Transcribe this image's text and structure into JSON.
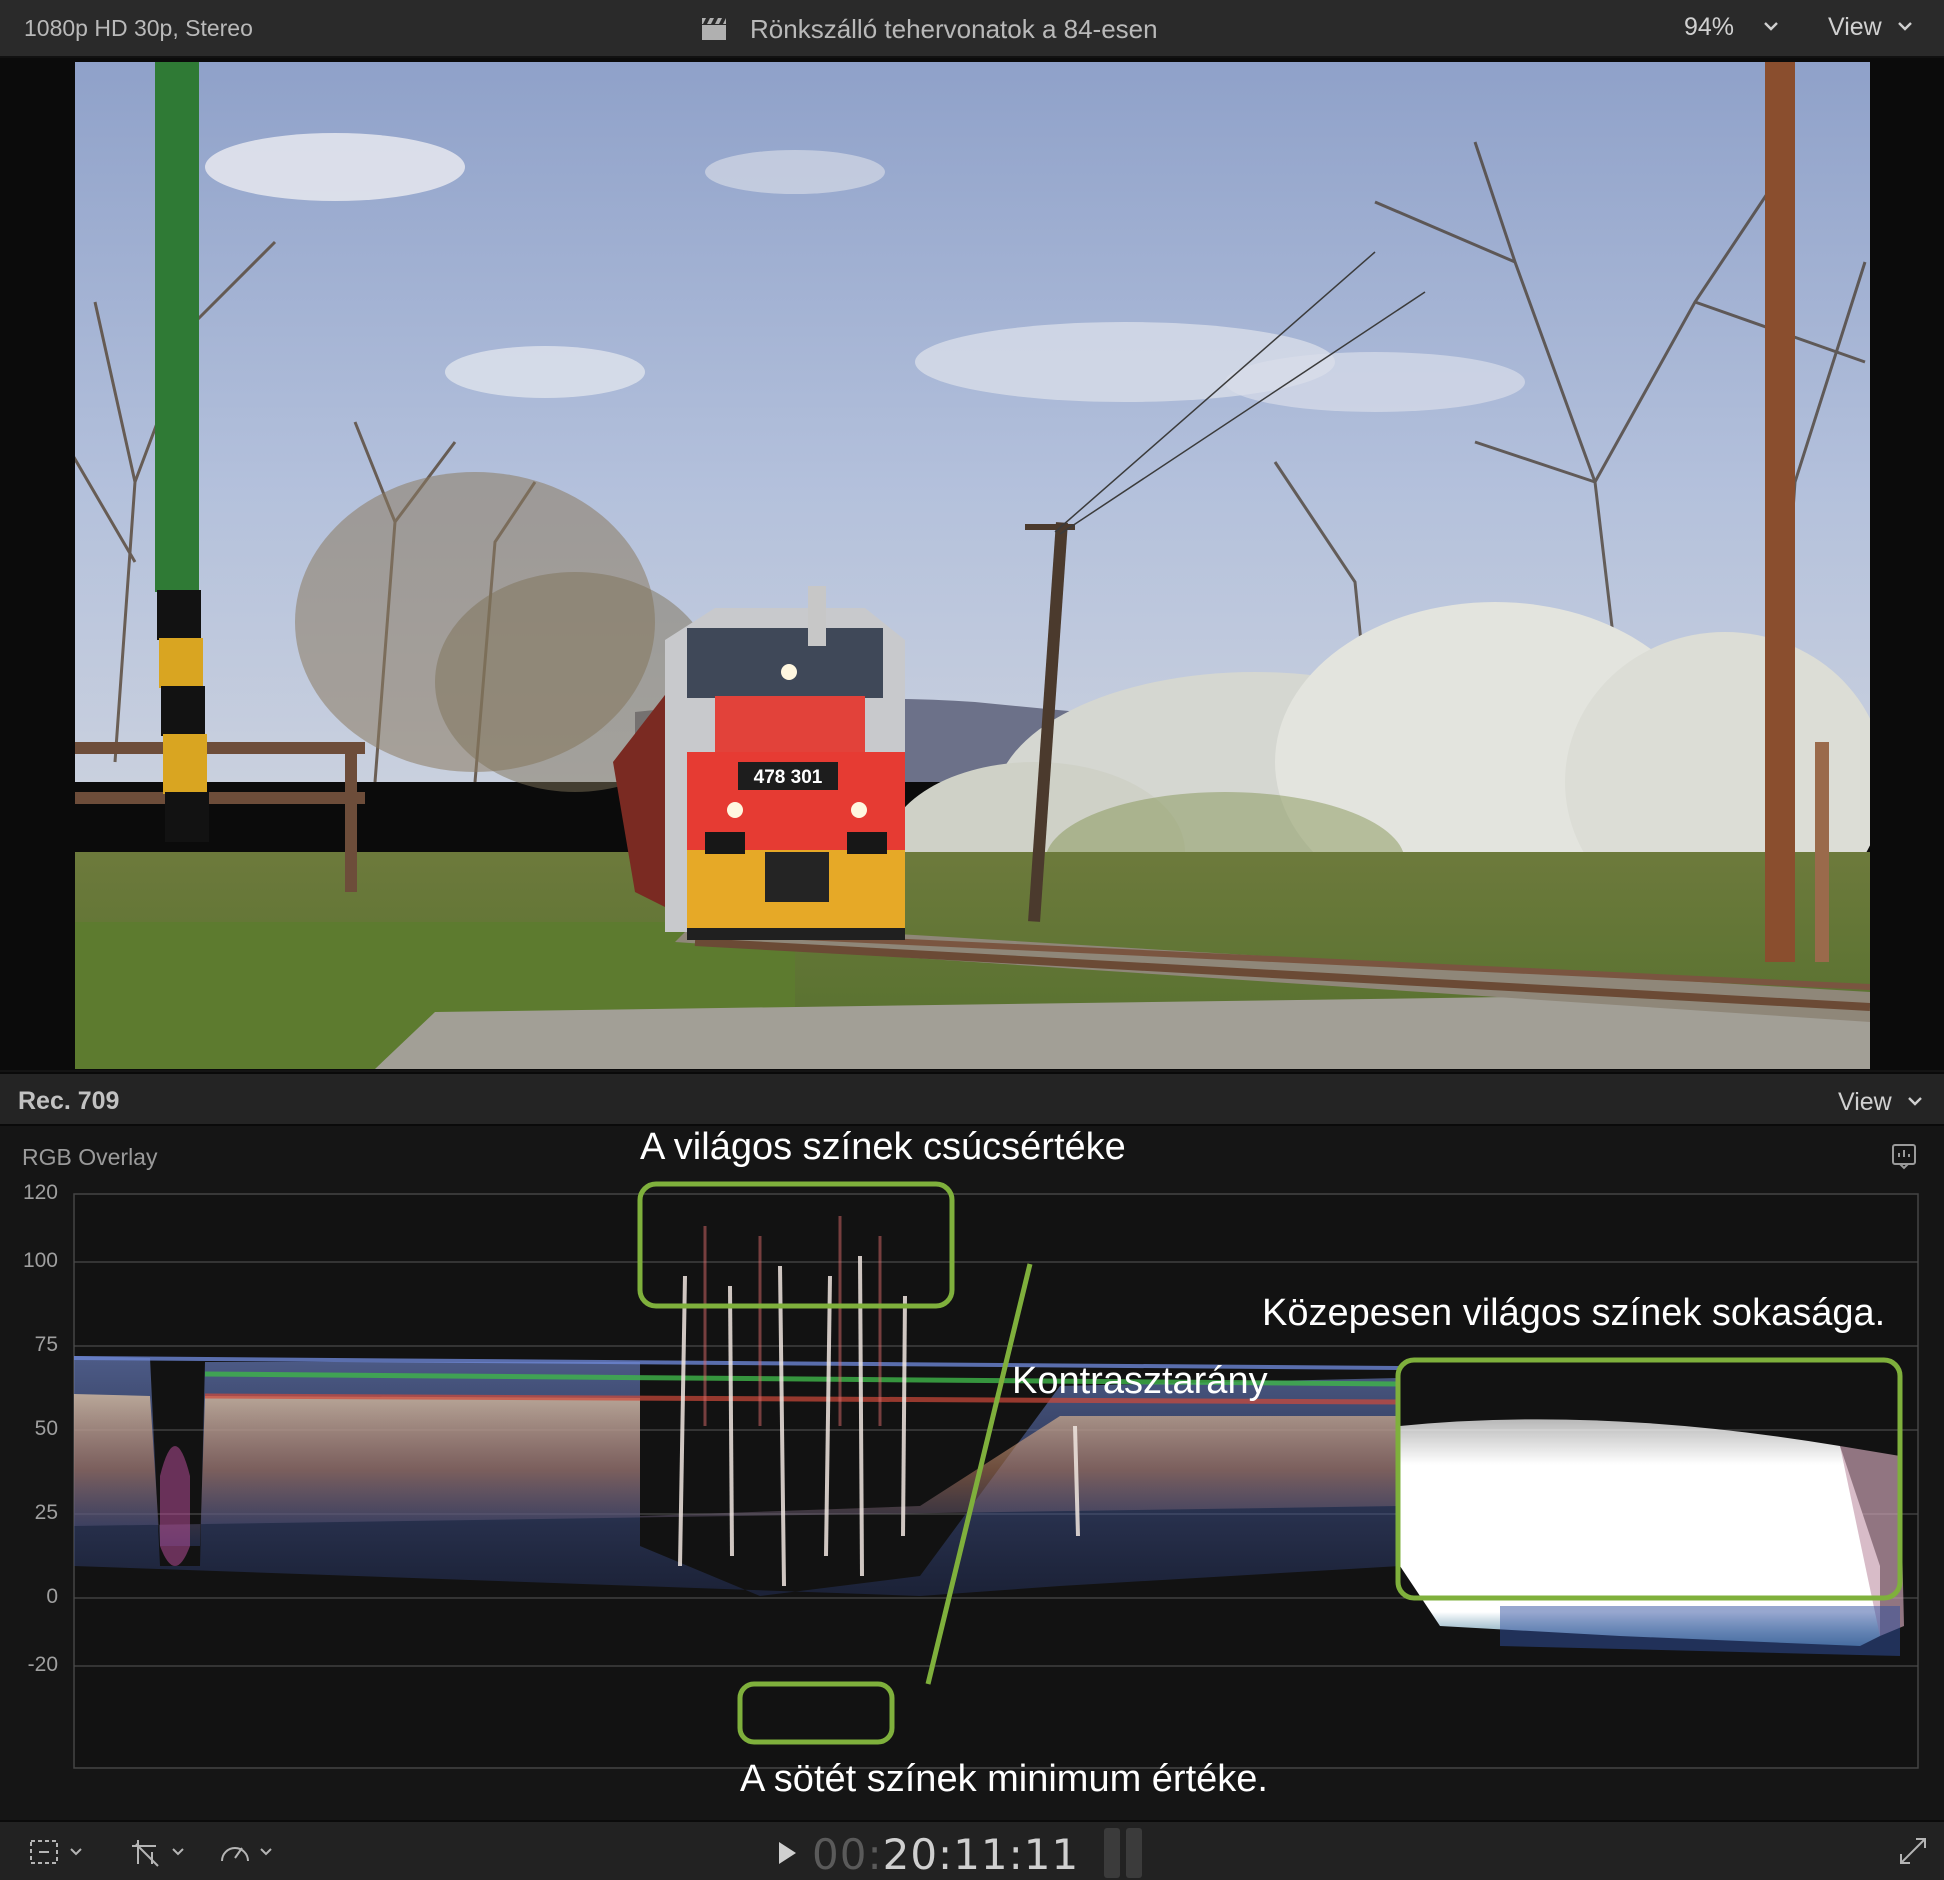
{
  "viewer": {
    "format": "1080p HD 30p, Stereo",
    "clip_icon": "clapperboard-icon",
    "title": "Rönkszálló tehervonatok a 84-esen",
    "zoom": "94%",
    "view_label": "View",
    "locomotive_number": "478 301"
  },
  "scope": {
    "standard": "Rec. 709",
    "view_label": "View",
    "mode": "RGB Overlay",
    "scale": [
      "120",
      "100",
      "75",
      "50",
      "25",
      "0",
      "-20"
    ],
    "annotations": {
      "peak": "A világos színek csúcsértéke",
      "mid": "Közepesen világos színek sokasága.",
      "contrast": "Kontrasztarány",
      "min": "A sötét színek minimum értéke."
    },
    "annotation_color": "#7fb03c"
  },
  "transport": {
    "timecode_dim": "00:",
    "timecode": "20:11:11"
  }
}
